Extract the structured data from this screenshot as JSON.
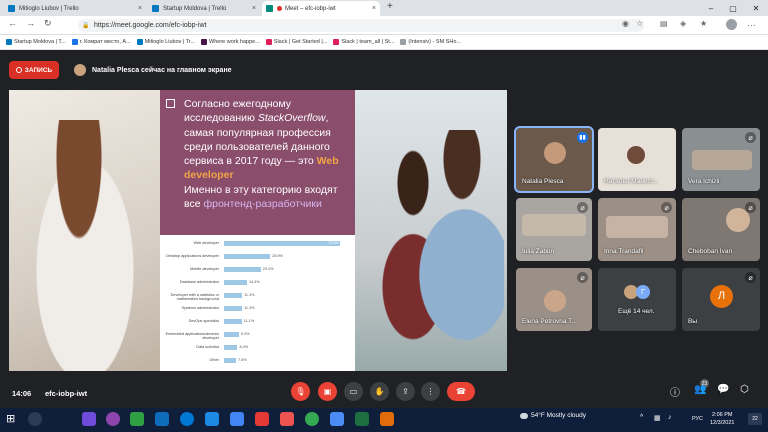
{
  "browser": {
    "tabs": [
      {
        "label": "Mitioglo Liubov | Trello",
        "color": "#0079bf",
        "active": false
      },
      {
        "label": "Startup Moldova | Trello",
        "color": "#0079bf",
        "active": false
      },
      {
        "label": "Meet – efc-iobp-iwt",
        "color": "#00897b",
        "active": true
      }
    ],
    "new_tab": "+",
    "url": "https://meet.google.com/efc-iobp-iwt",
    "bookmarks": [
      {
        "label": "Startup Moldova | T...",
        "color": "#0079bf"
      },
      {
        "label": "г. Комрат место, А...",
        "color": "#1a73e8"
      },
      {
        "label": "Mitioglo Liubov | Tr...",
        "color": "#0079bf"
      },
      {
        "label": "Where work happe...",
        "color": "#4a154b"
      },
      {
        "label": "Slack | Get Started |...",
        "color": "#e01e5a"
      },
      {
        "label": "Slack | team_all | St...",
        "color": "#e01e5a"
      },
      {
        "label": "(Intensiv) - SM SHo...",
        "color": "#9aa0a6"
      }
    ]
  },
  "meet": {
    "recording_label": "ЗАПИСЬ",
    "presenter_text": "Natalia Plesca сейчас на главном экране",
    "slide": {
      "line_before": "Согласно ежегодному исследованию ",
      "italic": "StackOverflow",
      "line_mid": ", самая популярная профессия среди пользователей данного сервиса в 2017 году — это ",
      "highlight": "Web developer",
      "line_after": "Именно в эту категорию входят все ",
      "light": "фронтенд-разработчики"
    },
    "tiles": [
      {
        "name": "Natalia Plesca",
        "speaking": true,
        "bg": "#6b5a4c"
      },
      {
        "name": "Наталья Манист...",
        "speaking": false,
        "bg": "#e6e0d8"
      },
      {
        "name": "Vera Ichizli",
        "speaking": false,
        "bg": "#8a8f92"
      },
      {
        "name": "Iulia Zabun",
        "speaking": false,
        "bg": "#a9a6a2"
      },
      {
        "name": "Inna Trandafil",
        "speaking": false,
        "bg": "#9b8f86"
      },
      {
        "name": "Cheboban Ivan",
        "speaking": false,
        "bg": "#7e7772"
      },
      {
        "name": "Elena Petrovna T...",
        "speaking": false,
        "bg": "#9a9088"
      },
      {
        "name": "Ещё 14 чел.",
        "speaking": false,
        "bg": "#3c4043"
      },
      {
        "name": "Вы",
        "speaking": false,
        "bg": "#3c4043",
        "avatar": "Л"
      }
    ],
    "extra_avatar": "Г",
    "time": "14:06",
    "meeting_code": "efc-iobp-iwt",
    "participants_count": "23"
  },
  "chart_data": {
    "type": "bar",
    "orientation": "horizontal",
    "categories": [
      "Web developer",
      "Desktop applications developer",
      "Mobile developer",
      "Database administrator",
      "Developer with a statistics or mathematics background",
      "Systems administrator",
      "DevOps specialist",
      "Embedded applications/devices developer",
      "Data scientist",
      "Other"
    ],
    "values": [
      72.6,
      28.9,
      23.0,
      14.4,
      11.3,
      11.3,
      11.1,
      9.3,
      8.4,
      7.5
    ],
    "value_labels": [
      "72.6%",
      "28.9%",
      "23.0%",
      "14.4%",
      "11.3%",
      "11.3%",
      "11.1%",
      "9.3%",
      "8.4%",
      "7.5%"
    ],
    "xlim": [
      0,
      80
    ],
    "bar_color": "#9fc7e6"
  },
  "taskbar": {
    "weather": "54°F  Mostly cloudy",
    "lang": "РУС",
    "clock_time": "2:06 PM",
    "clock_date": "12/3/2021",
    "notif": "22"
  }
}
